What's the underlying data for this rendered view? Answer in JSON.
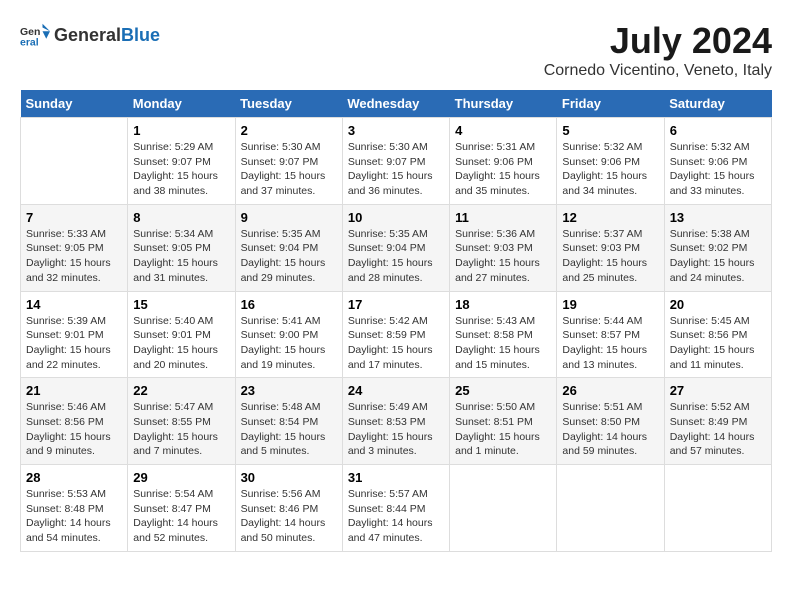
{
  "logo": {
    "general": "General",
    "blue": "Blue"
  },
  "title": "July 2024",
  "subtitle": "Cornedo Vicentino, Veneto, Italy",
  "header": {
    "days": [
      "Sunday",
      "Monday",
      "Tuesday",
      "Wednesday",
      "Thursday",
      "Friday",
      "Saturday"
    ]
  },
  "weeks": [
    {
      "cells": [
        {
          "day": null,
          "number": null,
          "sunrise": null,
          "sunset": null,
          "daylight": null
        },
        {
          "day": "Monday",
          "number": "1",
          "sunrise": "Sunrise: 5:29 AM",
          "sunset": "Sunset: 9:07 PM",
          "daylight": "Daylight: 15 hours and 38 minutes."
        },
        {
          "day": "Tuesday",
          "number": "2",
          "sunrise": "Sunrise: 5:30 AM",
          "sunset": "Sunset: 9:07 PM",
          "daylight": "Daylight: 15 hours and 37 minutes."
        },
        {
          "day": "Wednesday",
          "number": "3",
          "sunrise": "Sunrise: 5:30 AM",
          "sunset": "Sunset: 9:07 PM",
          "daylight": "Daylight: 15 hours and 36 minutes."
        },
        {
          "day": "Thursday",
          "number": "4",
          "sunrise": "Sunrise: 5:31 AM",
          "sunset": "Sunset: 9:06 PM",
          "daylight": "Daylight: 15 hours and 35 minutes."
        },
        {
          "day": "Friday",
          "number": "5",
          "sunrise": "Sunrise: 5:32 AM",
          "sunset": "Sunset: 9:06 PM",
          "daylight": "Daylight: 15 hours and 34 minutes."
        },
        {
          "day": "Saturday",
          "number": "6",
          "sunrise": "Sunrise: 5:32 AM",
          "sunset": "Sunset: 9:06 PM",
          "daylight": "Daylight: 15 hours and 33 minutes."
        }
      ]
    },
    {
      "cells": [
        {
          "day": "Sunday",
          "number": "7",
          "sunrise": "Sunrise: 5:33 AM",
          "sunset": "Sunset: 9:05 PM",
          "daylight": "Daylight: 15 hours and 32 minutes."
        },
        {
          "day": "Monday",
          "number": "8",
          "sunrise": "Sunrise: 5:34 AM",
          "sunset": "Sunset: 9:05 PM",
          "daylight": "Daylight: 15 hours and 31 minutes."
        },
        {
          "day": "Tuesday",
          "number": "9",
          "sunrise": "Sunrise: 5:35 AM",
          "sunset": "Sunset: 9:04 PM",
          "daylight": "Daylight: 15 hours and 29 minutes."
        },
        {
          "day": "Wednesday",
          "number": "10",
          "sunrise": "Sunrise: 5:35 AM",
          "sunset": "Sunset: 9:04 PM",
          "daylight": "Daylight: 15 hours and 28 minutes."
        },
        {
          "day": "Thursday",
          "number": "11",
          "sunrise": "Sunrise: 5:36 AM",
          "sunset": "Sunset: 9:03 PM",
          "daylight": "Daylight: 15 hours and 27 minutes."
        },
        {
          "day": "Friday",
          "number": "12",
          "sunrise": "Sunrise: 5:37 AM",
          "sunset": "Sunset: 9:03 PM",
          "daylight": "Daylight: 15 hours and 25 minutes."
        },
        {
          "day": "Saturday",
          "number": "13",
          "sunrise": "Sunrise: 5:38 AM",
          "sunset": "Sunset: 9:02 PM",
          "daylight": "Daylight: 15 hours and 24 minutes."
        }
      ]
    },
    {
      "cells": [
        {
          "day": "Sunday",
          "number": "14",
          "sunrise": "Sunrise: 5:39 AM",
          "sunset": "Sunset: 9:01 PM",
          "daylight": "Daylight: 15 hours and 22 minutes."
        },
        {
          "day": "Monday",
          "number": "15",
          "sunrise": "Sunrise: 5:40 AM",
          "sunset": "Sunset: 9:01 PM",
          "daylight": "Daylight: 15 hours and 20 minutes."
        },
        {
          "day": "Tuesday",
          "number": "16",
          "sunrise": "Sunrise: 5:41 AM",
          "sunset": "Sunset: 9:00 PM",
          "daylight": "Daylight: 15 hours and 19 minutes."
        },
        {
          "day": "Wednesday",
          "number": "17",
          "sunrise": "Sunrise: 5:42 AM",
          "sunset": "Sunset: 8:59 PM",
          "daylight": "Daylight: 15 hours and 17 minutes."
        },
        {
          "day": "Thursday",
          "number": "18",
          "sunrise": "Sunrise: 5:43 AM",
          "sunset": "Sunset: 8:58 PM",
          "daylight": "Daylight: 15 hours and 15 minutes."
        },
        {
          "day": "Friday",
          "number": "19",
          "sunrise": "Sunrise: 5:44 AM",
          "sunset": "Sunset: 8:57 PM",
          "daylight": "Daylight: 15 hours and 13 minutes."
        },
        {
          "day": "Saturday",
          "number": "20",
          "sunrise": "Sunrise: 5:45 AM",
          "sunset": "Sunset: 8:56 PM",
          "daylight": "Daylight: 15 hours and 11 minutes."
        }
      ]
    },
    {
      "cells": [
        {
          "day": "Sunday",
          "number": "21",
          "sunrise": "Sunrise: 5:46 AM",
          "sunset": "Sunset: 8:56 PM",
          "daylight": "Daylight: 15 hours and 9 minutes."
        },
        {
          "day": "Monday",
          "number": "22",
          "sunrise": "Sunrise: 5:47 AM",
          "sunset": "Sunset: 8:55 PM",
          "daylight": "Daylight: 15 hours and 7 minutes."
        },
        {
          "day": "Tuesday",
          "number": "23",
          "sunrise": "Sunrise: 5:48 AM",
          "sunset": "Sunset: 8:54 PM",
          "daylight": "Daylight: 15 hours and 5 minutes."
        },
        {
          "day": "Wednesday",
          "number": "24",
          "sunrise": "Sunrise: 5:49 AM",
          "sunset": "Sunset: 8:53 PM",
          "daylight": "Daylight: 15 hours and 3 minutes."
        },
        {
          "day": "Thursday",
          "number": "25",
          "sunrise": "Sunrise: 5:50 AM",
          "sunset": "Sunset: 8:51 PM",
          "daylight": "Daylight: 15 hours and 1 minute."
        },
        {
          "day": "Friday",
          "number": "26",
          "sunrise": "Sunrise: 5:51 AM",
          "sunset": "Sunset: 8:50 PM",
          "daylight": "Daylight: 14 hours and 59 minutes."
        },
        {
          "day": "Saturday",
          "number": "27",
          "sunrise": "Sunrise: 5:52 AM",
          "sunset": "Sunset: 8:49 PM",
          "daylight": "Daylight: 14 hours and 57 minutes."
        }
      ]
    },
    {
      "cells": [
        {
          "day": "Sunday",
          "number": "28",
          "sunrise": "Sunrise: 5:53 AM",
          "sunset": "Sunset: 8:48 PM",
          "daylight": "Daylight: 14 hours and 54 minutes."
        },
        {
          "day": "Monday",
          "number": "29",
          "sunrise": "Sunrise: 5:54 AM",
          "sunset": "Sunset: 8:47 PM",
          "daylight": "Daylight: 14 hours and 52 minutes."
        },
        {
          "day": "Tuesday",
          "number": "30",
          "sunrise": "Sunrise: 5:56 AM",
          "sunset": "Sunset: 8:46 PM",
          "daylight": "Daylight: 14 hours and 50 minutes."
        },
        {
          "day": "Wednesday",
          "number": "31",
          "sunrise": "Sunrise: 5:57 AM",
          "sunset": "Sunset: 8:44 PM",
          "daylight": "Daylight: 14 hours and 47 minutes."
        },
        {
          "day": null,
          "number": null,
          "sunrise": null,
          "sunset": null,
          "daylight": null
        },
        {
          "day": null,
          "number": null,
          "sunrise": null,
          "sunset": null,
          "daylight": null
        },
        {
          "day": null,
          "number": null,
          "sunrise": null,
          "sunset": null,
          "daylight": null
        }
      ]
    }
  ]
}
